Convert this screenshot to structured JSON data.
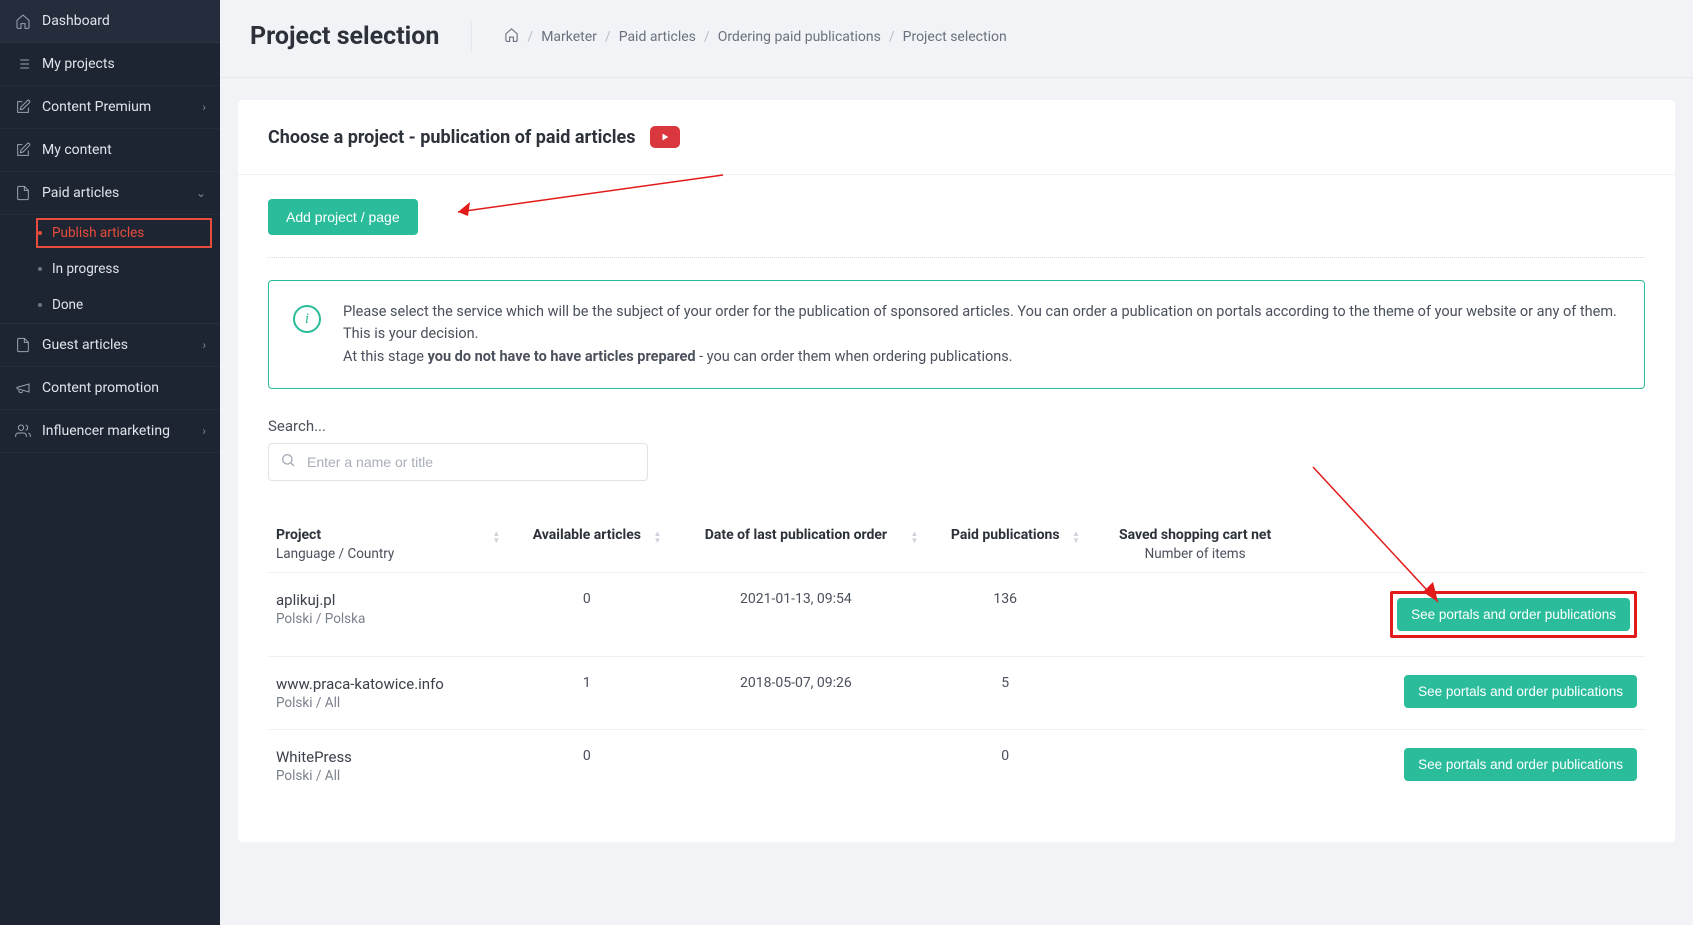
{
  "sidebar": {
    "items": [
      {
        "label": "Dashboard",
        "icon": "home"
      },
      {
        "label": "My projects",
        "icon": "list"
      },
      {
        "label": "Content Premium",
        "icon": "edit",
        "expandable": true
      },
      {
        "label": "My content",
        "icon": "edit"
      },
      {
        "label": "Paid articles",
        "icon": "file",
        "expanded": true,
        "children": [
          {
            "label": "Publish articles",
            "active": true
          },
          {
            "label": "In progress"
          },
          {
            "label": "Done"
          }
        ]
      },
      {
        "label": "Guest articles",
        "icon": "file",
        "expandable": true
      },
      {
        "label": "Content promotion",
        "icon": "megaphone"
      },
      {
        "label": "Influencer marketing",
        "icon": "users",
        "expandable": true
      }
    ]
  },
  "header": {
    "title": "Project selection",
    "breadcrumb": [
      "Marketer",
      "Paid articles",
      "Ordering paid publications",
      "Project selection"
    ]
  },
  "card": {
    "title": "Choose a project - publication of paid articles",
    "add_button": "Add project / page",
    "info_line1": "Please select the service which will be the subject of your order for the publication of sponsored articles. You can order a publication on portals according to the theme of your website or any of them. This is your decision.",
    "info_line2a": "At this stage ",
    "info_line2b": "you do not have to have articles prepared",
    "info_line2c": " - you can order them when ordering publications."
  },
  "search": {
    "label": "Search...",
    "placeholder": "Enter a name or title"
  },
  "table": {
    "headers": {
      "project": "Project",
      "project_sub": "Language / Country",
      "available": "Available articles",
      "date": "Date of last publication order",
      "paid": "Paid publications",
      "cart": "Saved shopping cart net",
      "cart_sub": "Number of items",
      "action": "See portals and order publications"
    },
    "rows": [
      {
        "name": "aplikuj.pl",
        "meta": "Polski / Polska",
        "available": "0",
        "date": "2021-01-13, 09:54",
        "paid": "136",
        "cart": "",
        "highlight": true
      },
      {
        "name": "www.praca-katowice.info",
        "meta": "Polski / All",
        "available": "1",
        "date": "2018-05-07, 09:26",
        "paid": "5",
        "cart": ""
      },
      {
        "name": "WhitePress",
        "meta": "Polski / All",
        "available": "0",
        "date": "",
        "paid": "0",
        "cart": ""
      }
    ]
  }
}
